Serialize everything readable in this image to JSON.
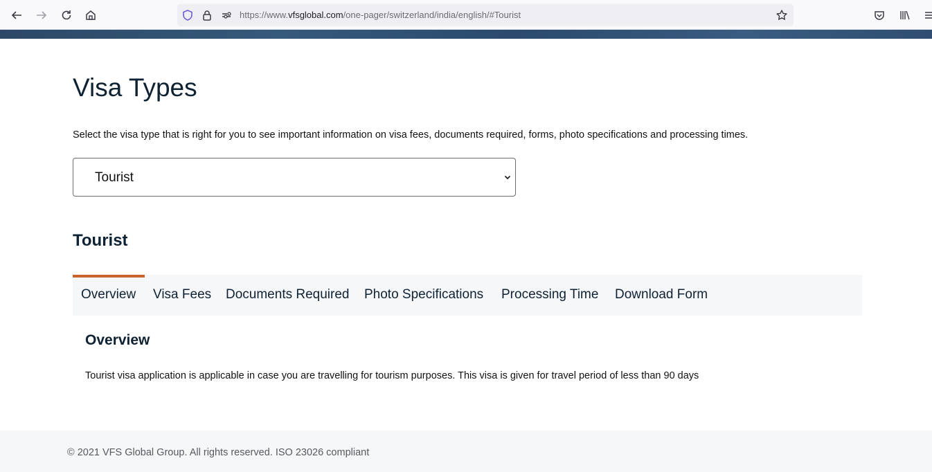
{
  "browser": {
    "url_prefix": "https://www.",
    "url_domain": "vfsglobal.com",
    "url_path": "/one-pager/switzerland/india/english/#Tourist",
    "icons": [
      "back-icon",
      "forward-icon",
      "reload-icon",
      "home-icon",
      "shield-icon",
      "lock-icon",
      "permissions-icon",
      "bookmark-star-icon",
      "pocket-icon",
      "library-icon",
      "menu-icon"
    ]
  },
  "page": {
    "title": "Visa Types",
    "intro": "Select the visa type that is right for you to see important information on visa fees, documents required, forms, photo specifications and processing times.",
    "visa_select": {
      "selected": "Tourist"
    },
    "subtitle": "Tourist",
    "tabs": [
      {
        "label": "Overview",
        "active": true
      },
      {
        "label": "Visa Fees",
        "active": false
      },
      {
        "label": "Documents Required",
        "active": false
      },
      {
        "label": "Photo Specifications",
        "active": false
      },
      {
        "label": "Processing Time",
        "active": false
      },
      {
        "label": "Download Form",
        "active": false
      }
    ],
    "section": {
      "title": "Overview",
      "text": "Tourist visa application is applicable in case you are travelling for tourism purposes. This visa is given for travel period of less than 90 days"
    },
    "accent_color": "#c9652b"
  },
  "footer": {
    "text": "© 2021 VFS Global Group. All rights reserved. ISO 23026 compliant"
  }
}
